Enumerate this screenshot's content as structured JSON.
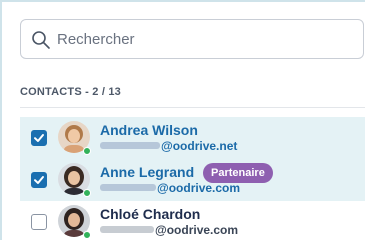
{
  "search": {
    "placeholder": "Rechercher"
  },
  "contacts": {
    "title": "CONTACTS - 2 / 13",
    "items": [
      {
        "name": "Andrea Wilson",
        "email_domain": "@oodrive.net",
        "checked": true,
        "badge": ""
      },
      {
        "name": "Anne Legrand",
        "email_domain": "@oodrive.com",
        "checked": true,
        "badge": "Partenaire"
      },
      {
        "name": "Chloé Chardon",
        "email_domain": "@oodrive.com",
        "checked": false,
        "badge": ""
      }
    ]
  },
  "colors": {
    "accent": "#1a6fb0",
    "selected_row": "#e4f2f5",
    "badge": "#8e5fb0",
    "online": "#32b25a"
  }
}
